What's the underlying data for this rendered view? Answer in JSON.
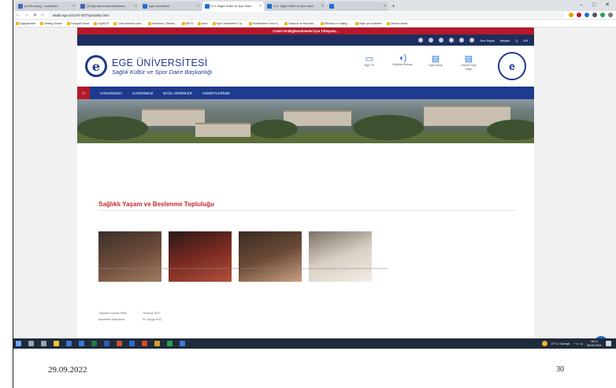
{
  "browser": {
    "tabs": [
      {
        "title": "(8.409 sonuç) - muhendisl...",
        "color": "#4267b2"
      },
      {
        "title": "(3) Ege Üniversitesi Beslenme...",
        "color": "#4267b2"
      },
      {
        "title": "Ege Üniversitesi",
        "color": "#1d6fd1"
      },
      {
        "title": "E.Ü. Sağlık Kültür ve Spor Daire",
        "color": "#1d6fd1",
        "active": true
      },
      {
        "title": "E.Ü. Sağlık Kültür ve Spor Daire",
        "color": "#1d6fd1"
      },
      {
        "title": "",
        "color": "#1d6fd1"
      }
    ],
    "url": "sksdb.ege.edu.tr/tr-3/3/Topluluklar.html",
    "bookmarks": [
      "Uygulamalar",
      "Setting Sense",
      "Fotoğraf Sanat",
      "EgeEDU",
      "Child Nutrition and...",
      "Dietitians | Sterillo...",
      "EBYS",
      "arsiv",
      "Ege Üniversitesi Tıp...",
      "Mutfakhane Fono A...",
      "Dawood ve Mücahit...",
      "Diffusion in Eating ...",
      "Diğer yer işaretleri",
      "Okuma listesi"
    ]
  },
  "site": {
    "covid_banner": "Covid-19 Bilgilendirmeleri İçin Tıklayınız...",
    "top_links": [
      "Ana Sayfa",
      "İletişim",
      "Q",
      "EN"
    ],
    "brand_title": "EGE ÜNİVERSİTESİ",
    "brand_subtitle": "Sağlık Kültür ve Spor Daire Başkanlığı",
    "logo_letter": "e",
    "quick_links": [
      {
        "icon": "monitor",
        "glyph": "▭",
        "label": "Ege TV"
      },
      {
        "icon": "speaker",
        "glyph": "◖)",
        "label": "Dilekçe Kutusu"
      },
      {
        "icon": "document",
        "glyph": "▤",
        "label": "Ege Dergi"
      },
      {
        "icon": "document",
        "glyph": "▤",
        "label": "Online Ekip Takip"
      }
    ],
    "menu": [
      "HAKKIMIZDA",
      "KADROMUZ",
      "BAĞLI BİRİMLER",
      "HİZMETLERİMİZ"
    ],
    "page_title": "Sağlıklı Yaşam ve Beslenme Topluluğu",
    "description": "Topluluğumuzun amacı sağlıklı yaşam tarzlarının ana sahalarından biri olan beslenme konusunda bilgilenmek, toplumu bilinçlendirmek ve farkındalık oluşturmaktır. Sağlıklı beslenme ile ilgili paneller, seminerler, atölye çalışmaları ve sosyal sorumluluk projeleri düzenlenmektedir.",
    "meta": [
      {
        "key": "Topluluk Kuruluş Tarihi",
        "value": "Temmuz 2017"
      },
      {
        "key": "Akademik Danışman",
        "value": "Dr. Duygu KOÇ"
      }
    ],
    "photos": [
      {
        "name": "seminar-photo",
        "colors": [
          "#3a2f2a",
          "#6b4a3a",
          "#a07a60"
        ]
      },
      {
        "name": "audience-photo",
        "colors": [
          "#2a1a18",
          "#7a2a22",
          "#b2503a"
        ]
      },
      {
        "name": "hall-photo",
        "colors": [
          "#3a2a22",
          "#6a4a36",
          "#caa084"
        ]
      },
      {
        "name": "group-photo",
        "colors": [
          "#7a7066",
          "#d8cfc4",
          "#f2ede6"
        ]
      }
    ]
  },
  "taskbar": {
    "weather": "27°C Güneşli",
    "time": "18:11",
    "date": "28.06.2021"
  },
  "slide": {
    "date": "29.09.2022",
    "page_number": "30"
  }
}
